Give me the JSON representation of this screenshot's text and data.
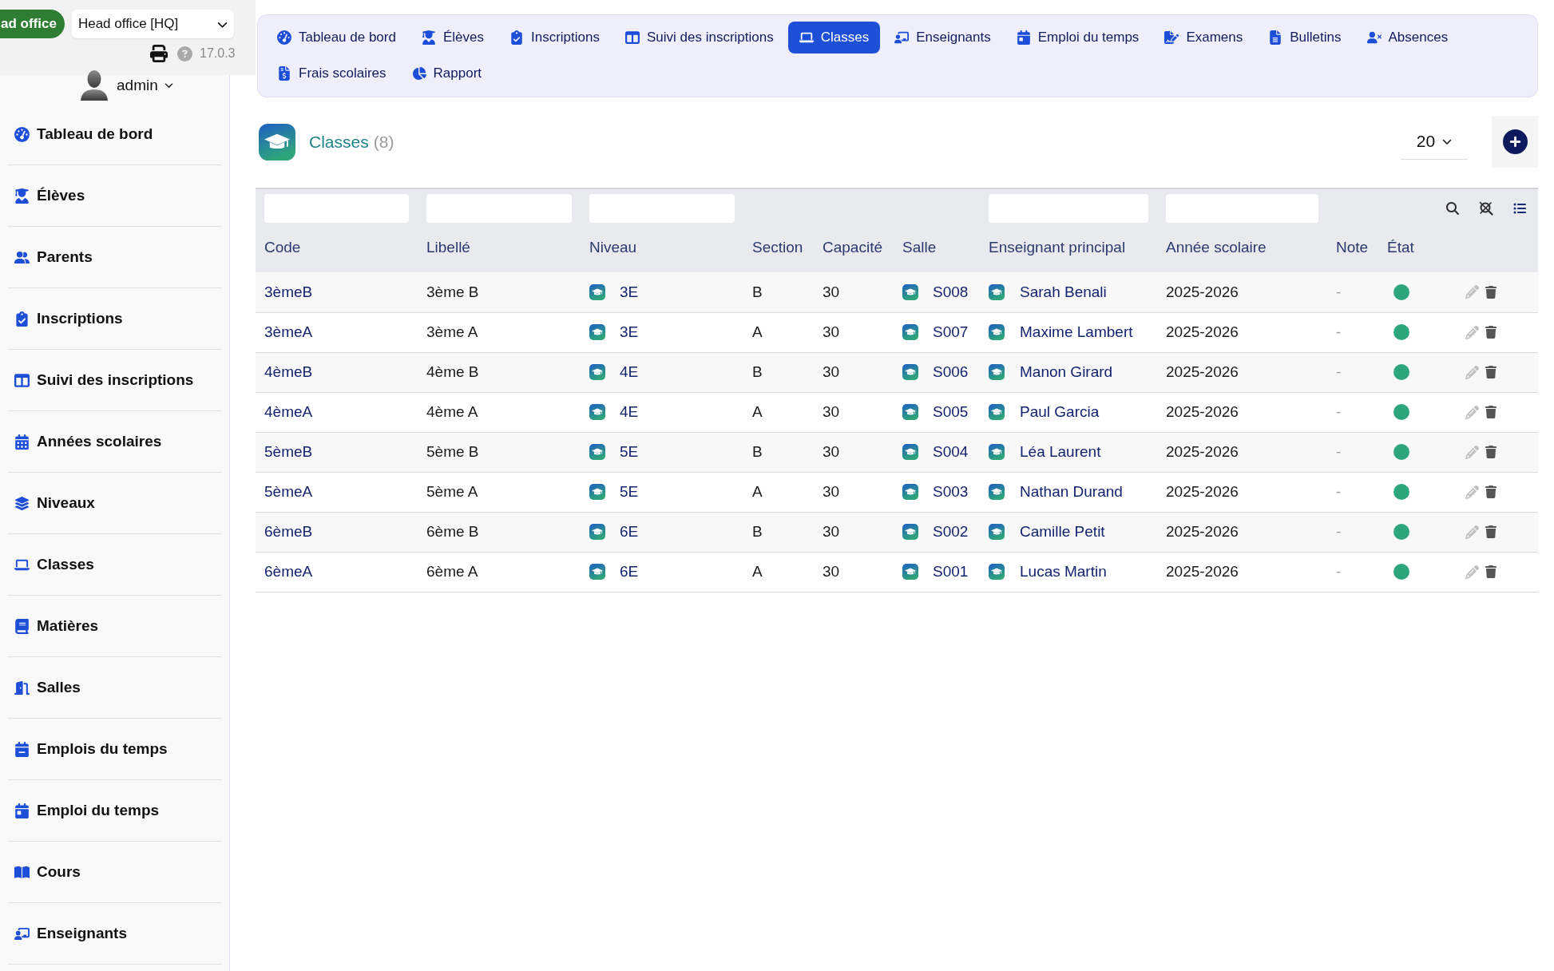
{
  "header": {
    "branch_badge": "ad office",
    "branch_select": "Head office [HQ]",
    "version": "17.0.3",
    "user": "admin"
  },
  "nav_tabs": [
    {
      "label": "Tableau de bord",
      "selected": false
    },
    {
      "label": "Élèves",
      "selected": false
    },
    {
      "label": "Inscriptions",
      "selected": false
    },
    {
      "label": "Suivi des inscriptions",
      "selected": false
    },
    {
      "label": "Classes",
      "selected": true
    },
    {
      "label": "Enseignants",
      "selected": false
    },
    {
      "label": "Emploi du temps",
      "selected": false
    },
    {
      "label": "Examens",
      "selected": false
    },
    {
      "label": "Bulletins",
      "selected": false
    },
    {
      "label": "Absences",
      "selected": false
    },
    {
      "label": "Frais scolaires",
      "selected": false
    },
    {
      "label": "Rapport",
      "selected": false
    }
  ],
  "sidebar": {
    "items": [
      "Tableau de bord",
      "Élèves",
      "Parents",
      "Inscriptions",
      "Suivi des inscriptions",
      "Années scolaires",
      "Niveaux",
      "Classes",
      "Matières",
      "Salles",
      "Emplois du temps",
      "Emploi du temps",
      "Cours",
      "Enseignants"
    ]
  },
  "page": {
    "title": "Classes",
    "count": "(8)",
    "page_size": "20"
  },
  "table": {
    "columns": [
      {
        "label": "Code",
        "filter": true
      },
      {
        "label": "Libellé",
        "filter": true
      },
      {
        "label": "Niveau",
        "filter": true
      },
      {
        "label": "Section",
        "filter": false
      },
      {
        "label": "Capacité",
        "filter": false
      },
      {
        "label": "Salle",
        "filter": false
      },
      {
        "label": "Enseignant principal",
        "filter": true
      },
      {
        "label": "Année scolaire",
        "filter": true
      },
      {
        "label": "Note",
        "filter": false
      },
      {
        "label": "État",
        "filter": false
      }
    ],
    "rows": [
      {
        "code": "3èmeB",
        "libelle": "3ème B",
        "niveau": "3E",
        "section": "B",
        "capacite": "30",
        "salle": "S008",
        "enseignant": "Sarah Benali",
        "annee": "2025-2026",
        "note": "-",
        "active": true
      },
      {
        "code": "3èmeA",
        "libelle": "3ème A",
        "niveau": "3E",
        "section": "A",
        "capacite": "30",
        "salle": "S007",
        "enseignant": "Maxime Lambert",
        "annee": "2025-2026",
        "note": "-",
        "active": true
      },
      {
        "code": "4èmeB",
        "libelle": "4ème B",
        "niveau": "4E",
        "section": "B",
        "capacite": "30",
        "salle": "S006",
        "enseignant": "Manon Girard",
        "annee": "2025-2026",
        "note": "-",
        "active": true
      },
      {
        "code": "4èmeA",
        "libelle": "4ème A",
        "niveau": "4E",
        "section": "A",
        "capacite": "30",
        "salle": "S005",
        "enseignant": "Paul Garcia",
        "annee": "2025-2026",
        "note": "-",
        "active": true
      },
      {
        "code": "5èmeB",
        "libelle": "5ème B",
        "niveau": "5E",
        "section": "B",
        "capacite": "30",
        "salle": "S004",
        "enseignant": "Léa Laurent",
        "annee": "2025-2026",
        "note": "-",
        "active": true
      },
      {
        "code": "5èmeA",
        "libelle": "5ème A",
        "niveau": "5E",
        "section": "A",
        "capacite": "30",
        "salle": "S003",
        "enseignant": "Nathan Durand",
        "annee": "2025-2026",
        "note": "-",
        "active": true
      },
      {
        "code": "6èmeB",
        "libelle": "6ème B",
        "niveau": "6E",
        "section": "B",
        "capacite": "30",
        "salle": "S002",
        "enseignant": "Camille Petit",
        "annee": "2025-2026",
        "note": "-",
        "active": true
      },
      {
        "code": "6èmeA",
        "libelle": "6ème A",
        "niveau": "6E",
        "section": "A",
        "capacite": "30",
        "salle": "S001",
        "enseignant": "Lucas Martin",
        "annee": "2025-2026",
        "note": "-",
        "active": true
      }
    ]
  }
}
